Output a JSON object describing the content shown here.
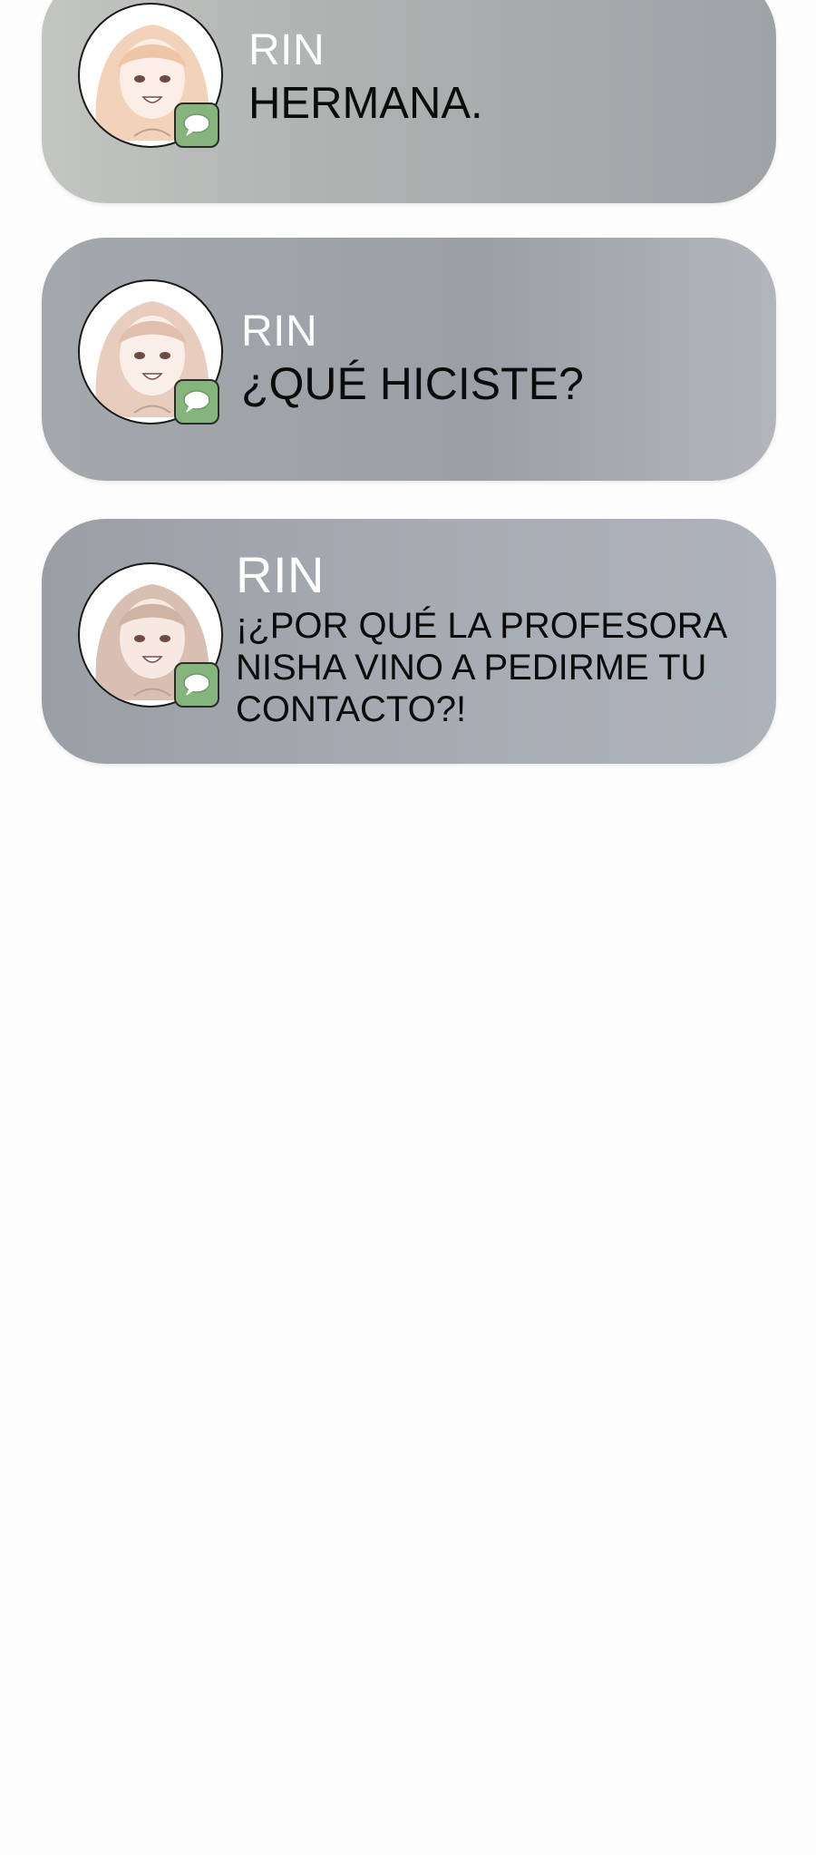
{
  "notifications": [
    {
      "sender": "RIN",
      "message": "HERMANA."
    },
    {
      "sender": "RIN",
      "message": "¿QUÉ HICISTE?"
    },
    {
      "sender": "RIN",
      "message": "¡¿POR QUÉ LA PROFESORA NISHA VINO A PEDIRME TU CONTACTO?!"
    }
  ],
  "colors": {
    "badge": "#86b47d",
    "sender_text": "#ffffff",
    "message_text": "#0b0b0b",
    "background": "#fdfdfd"
  },
  "icons": {
    "avatar": "avatar-portrait-icon",
    "app_badge": "message-bubble-icon"
  }
}
